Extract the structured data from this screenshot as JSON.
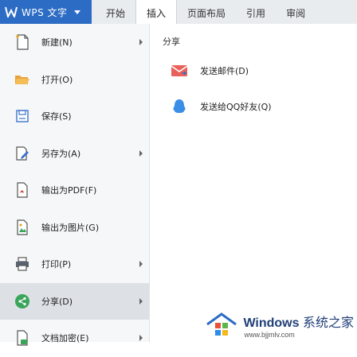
{
  "app": {
    "menu_button": "WPS 文字",
    "tabs": [
      "开始",
      "插入",
      "页面布局",
      "引用",
      "审阅"
    ],
    "active_tab": "插入"
  },
  "menu": {
    "items": [
      {
        "label": "新建(N)",
        "icon": "new-document-icon",
        "has_arrow": true
      },
      {
        "label": "打开(O)",
        "icon": "folder-open-icon",
        "has_arrow": false
      },
      {
        "label": "保存(S)",
        "icon": "save-icon",
        "has_arrow": false
      },
      {
        "label": "另存为(A)",
        "icon": "save-as-icon",
        "has_arrow": true
      },
      {
        "label": "输出为PDF(F)",
        "icon": "export-pdf-icon",
        "has_arrow": false
      },
      {
        "label": "输出为图片(G)",
        "icon": "export-image-icon",
        "has_arrow": false
      },
      {
        "label": "打印(P)",
        "icon": "print-icon",
        "has_arrow": true
      },
      {
        "label": "分享(D)",
        "icon": "share-icon",
        "has_arrow": true,
        "active": true
      },
      {
        "label": "文档加密(E)",
        "icon": "encrypt-icon",
        "has_arrow": true
      }
    ]
  },
  "panel": {
    "title": "分享",
    "items": [
      {
        "label": "发送邮件(D)",
        "icon": "mail-icon"
      },
      {
        "label": "发送给QQ好友(Q)",
        "icon": "qq-icon"
      }
    ]
  },
  "watermark": {
    "brand": "Windows",
    "brand_cn": "系统之家",
    "url": "www.bjjmlv.com"
  },
  "colors": {
    "wps_blue": "#2c6cc4",
    "menu_bg": "#f6f7f9",
    "active_item": "#dde1e6",
    "mail_red": "#e8625b",
    "qq_blue": "#3a8ee6",
    "share_green": "#3aa55a"
  }
}
